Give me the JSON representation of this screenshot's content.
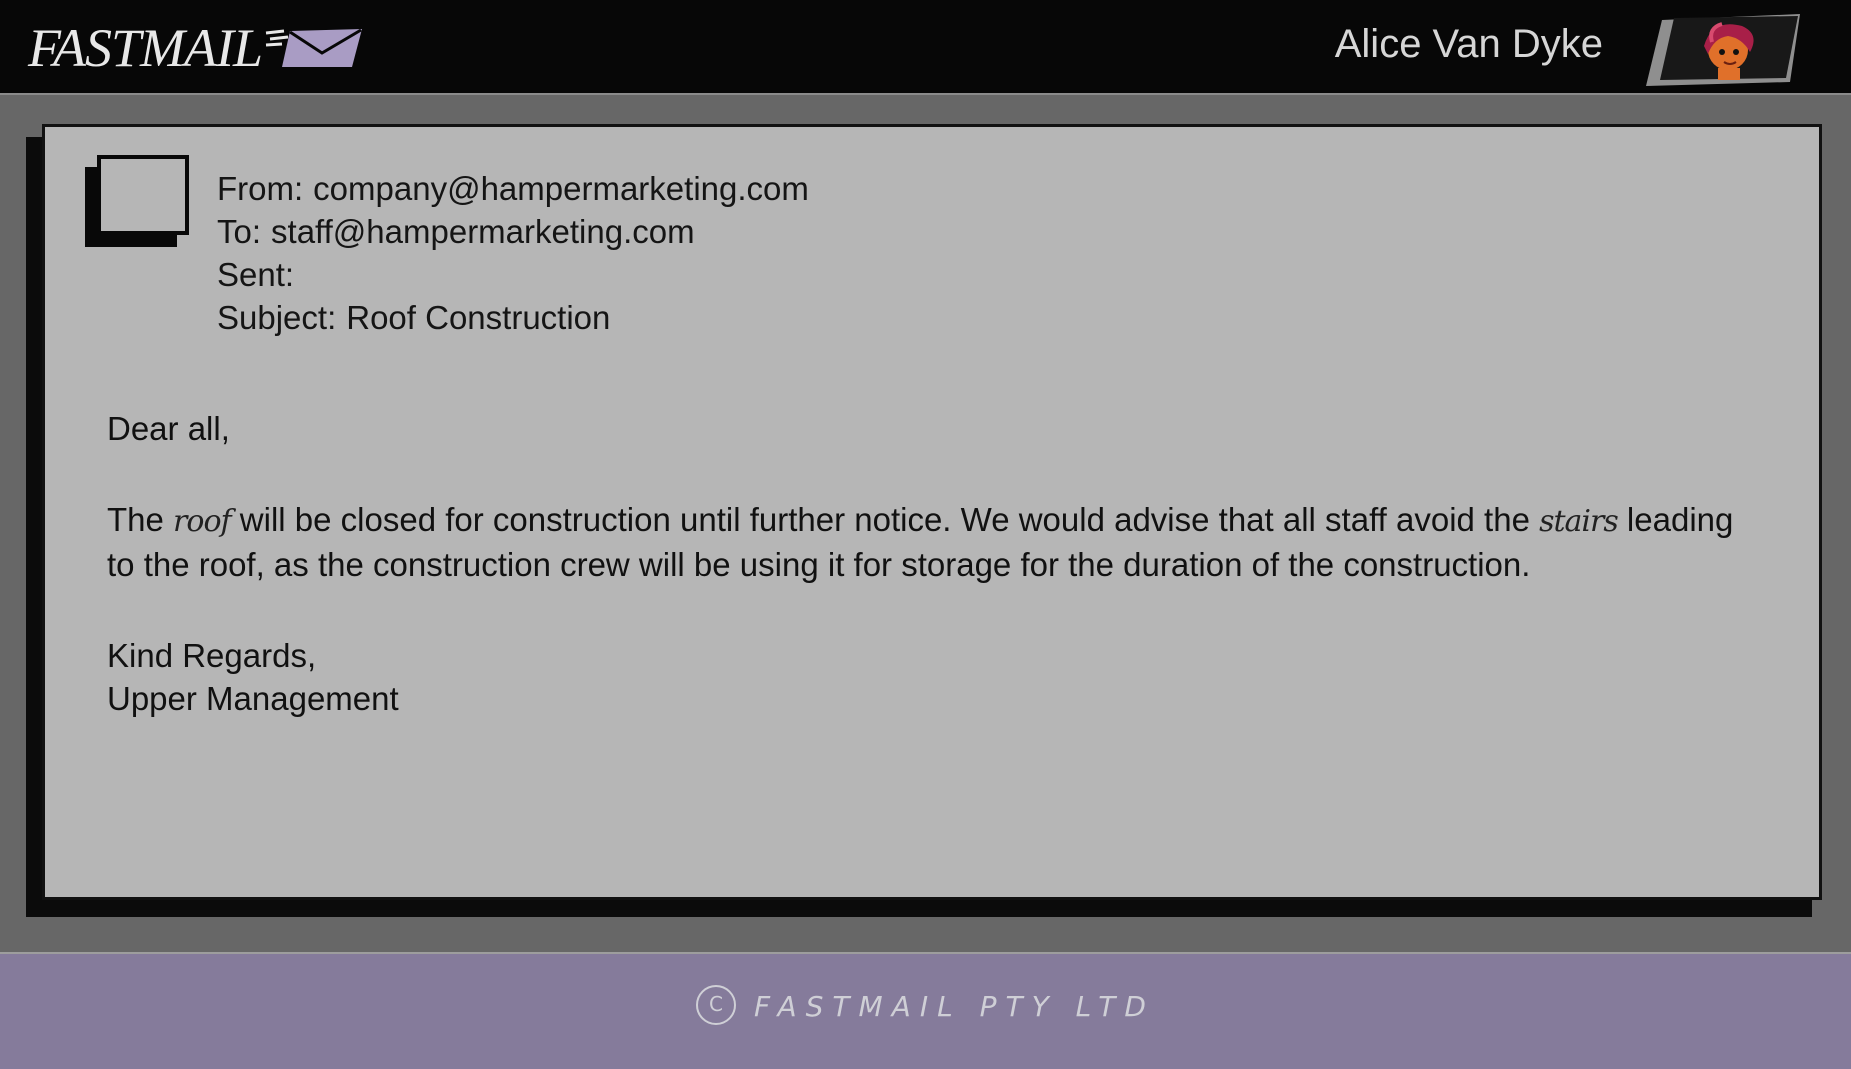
{
  "app": {
    "logo_text": "FASTMAIL",
    "logo_icon": "envelope-icon",
    "user_name": "Alice Van Dyke",
    "user_avatar": "user-avatar-portrait"
  },
  "email": {
    "from_label": "From:",
    "from_value": "company@hampermarketing.com",
    "to_label": "To:",
    "to_value": "staff@hampermarketing.com",
    "sent_label": "Sent:",
    "sent_value": "",
    "subject_label": "Subject:",
    "subject_value": "Roof Construction",
    "greeting": "Dear all,",
    "body_part1": "The ",
    "body_hand1": "roof",
    "body_part2": " will be closed for construction until further notice. We would advise that all staff avoid the ",
    "body_hand2": "stairs",
    "body_part3": " leading to the roof, as the construction crew will be using it for storage for the duration of the construction.",
    "signoff": "Kind Regards,",
    "signature": "Upper Management"
  },
  "footer": {
    "copyright_symbol": "C",
    "copyright_text": "FASTMAIL PTY LTD"
  },
  "colors": {
    "topbar": "#070707",
    "background": "#676767",
    "card": "#b6b6b6",
    "footer": "#857b9b",
    "envelope": "#a99cc4"
  }
}
